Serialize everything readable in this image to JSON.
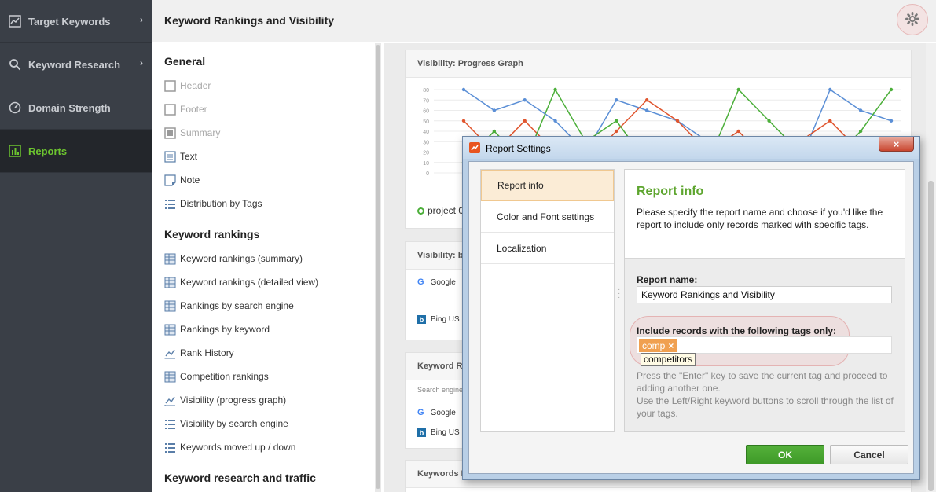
{
  "nav": {
    "items": [
      {
        "label": "Target Keywords",
        "icon": "line-chart-icon"
      },
      {
        "label": "Keyword Research",
        "icon": "search-icon"
      },
      {
        "label": "Domain Strength",
        "icon": "gauge-icon"
      },
      {
        "label": "Reports",
        "icon": "bar-chart-icon"
      }
    ],
    "active": "Reports",
    "accent": "#6cc42f"
  },
  "header": {
    "title": "Keyword Rankings and Visibility"
  },
  "elements": {
    "sections": [
      {
        "title": "General",
        "items": [
          {
            "label": "Header",
            "icon": "square-icon",
            "disabled": true
          },
          {
            "label": "Footer",
            "icon": "square-icon",
            "disabled": true
          },
          {
            "label": "Summary",
            "icon": "square-icon",
            "disabled": true
          },
          {
            "label": "Text",
            "icon": "text-icon",
            "disabled": false
          },
          {
            "label": "Note",
            "icon": "note-icon",
            "disabled": false
          },
          {
            "label": "Distribution by Tags",
            "icon": "list-icon",
            "disabled": false
          }
        ]
      },
      {
        "title": "Keyword rankings",
        "items": [
          {
            "label": "Keyword rankings (summary)",
            "icon": "table-icon"
          },
          {
            "label": "Keyword rankings (detailed view)",
            "icon": "table-icon"
          },
          {
            "label": "Rankings by search engine",
            "icon": "table-icon"
          },
          {
            "label": "Rankings by keyword",
            "icon": "table-icon"
          },
          {
            "label": "Rank History",
            "icon": "line-chart-icon"
          },
          {
            "label": "Competition rankings",
            "icon": "table-icon"
          },
          {
            "label": "Visibility (progress graph)",
            "icon": "line-chart-icon"
          },
          {
            "label": "Visibility by search engine",
            "icon": "list-icon"
          },
          {
            "label": "Keywords moved up / down",
            "icon": "list-icon"
          }
        ]
      },
      {
        "title": "Keyword research and traffic",
        "items": []
      }
    ]
  },
  "preview": {
    "card1": {
      "title": "Visibility: Progress Graph",
      "yticks": [
        "80",
        "70",
        "60",
        "50",
        "40",
        "30",
        "20",
        "10",
        "0"
      ],
      "legend": "project 0"
    },
    "card2": {
      "title": "Visibility: by",
      "engines": [
        "Google",
        "Bing US"
      ]
    },
    "card3": {
      "title": "Keyword Ra",
      "subheader": "Search engine",
      "engines": [
        "Google",
        "Bing US"
      ]
    },
    "card4": {
      "title": "Keywords M"
    }
  },
  "chart_data": {
    "type": "line",
    "ylim": [
      0,
      80
    ],
    "yticks": [
      0,
      10,
      20,
      30,
      40,
      50,
      60,
      70,
      80
    ],
    "series": [
      {
        "color": "#5b8fd6",
        "values": [
          80,
          60,
          70,
          50,
          20,
          70,
          60,
          50,
          30,
          10,
          20,
          10,
          80,
          60,
          50
        ]
      },
      {
        "color": "#e0552e",
        "values": [
          50,
          20,
          50,
          20,
          10,
          40,
          70,
          50,
          20,
          40,
          10,
          30,
          50,
          20,
          30
        ]
      },
      {
        "color": "#4caf3a",
        "values": [
          10,
          40,
          10,
          80,
          30,
          50,
          10,
          20,
          10,
          80,
          50,
          20,
          10,
          40,
          80
        ]
      }
    ]
  },
  "dialog": {
    "title": "Report Settings",
    "close_label": "×",
    "tabs": [
      "Report info",
      "Color and Font settings",
      "Localization"
    ],
    "active_tab": "Report info",
    "info_title": "Report info",
    "info_desc": "Please specify the report name and choose if you'd like the report to include only records marked with specific tags.",
    "name_label": "Report name:",
    "name_value": "Keyword Rankings and Visibility",
    "tags_label": "Include records with the following tags only:",
    "tag_chip": "comp",
    "tag_remove": "×",
    "suggestion": "competitors",
    "hint1": "Press the \"Enter\" key to save the current tag and proceed to adding another one.",
    "hint2": "Use the Left/Right keyword buttons to scroll through the list of your tags.",
    "ok_label": "OK",
    "cancel_label": "Cancel"
  }
}
